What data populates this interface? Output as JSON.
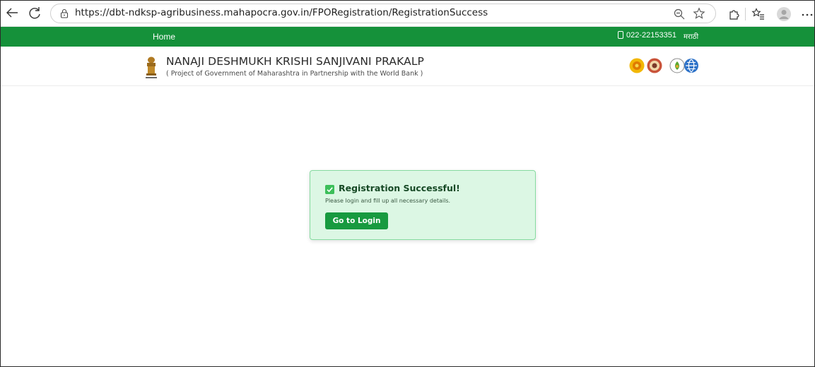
{
  "browser": {
    "url": "https://dbt-ndksp-agribusiness.mahapocra.gov.in/FPORegistration/RegistrationSuccess",
    "icons": [
      "back-icon",
      "refresh-icon",
      "lock-icon",
      "zoom-icon",
      "favorite-star-icon",
      "extensions-icon",
      "favorites-icon",
      "profile-icon",
      "more-icon"
    ]
  },
  "topnav": {
    "home_label": "Home",
    "phone": "022-22153351",
    "language": "मराठी",
    "color": "#15913a"
  },
  "header": {
    "title": "NANAJI DESHMUKH KRISHI SANJIVANI PRAKALP",
    "subtitle": "( Project of Government of Maharashtra in Partnership with the World Bank )"
  },
  "success": {
    "title": "Registration Successful!",
    "message": "Please login and fill up all necessary details.",
    "button_label": "Go to Login",
    "bg_color": "#dcf7e4",
    "button_color": "#189a40"
  }
}
